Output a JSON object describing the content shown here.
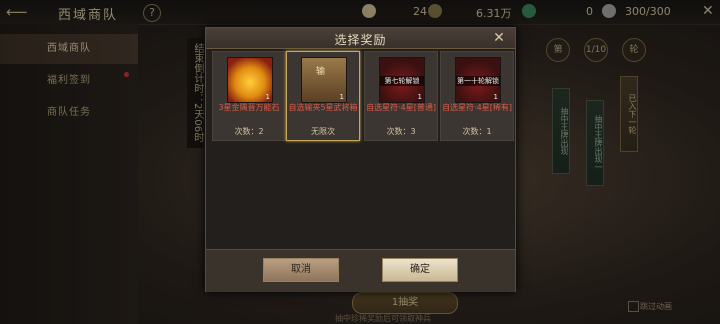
{
  "header": {
    "back_icon": "back-arrow-icon",
    "title": "西域商队",
    "help": "?",
    "res1": "24",
    "res2": "6.31万",
    "res3": "0",
    "res4": "300/300",
    "close": "✕"
  },
  "sidebar": {
    "items": [
      {
        "label": "西域商队",
        "active": true
      },
      {
        "label": "福利签到",
        "active": false
      },
      {
        "label": "商队任务",
        "active": false
      }
    ]
  },
  "timer": {
    "label": "结束倒计时：2天06时"
  },
  "right": {
    "badge_left": "第",
    "badge_mid": "1/10",
    "badge_right": "轮",
    "banner1": "抽中王牌出现",
    "banner2": "抽中王牌出现一",
    "banner3": "已入下一轮"
  },
  "bottom": {
    "draw_button": "1抽奖",
    "note": "抽中珍稀奖励后可领取神兵",
    "skip": "跳过动画"
  },
  "dialog": {
    "title": "选择奖励",
    "close": "✕",
    "items": [
      {
        "name": "3星金隅晋万能石",
        "count": "次数：2",
        "qty": "1",
        "selected": false,
        "overlay": ""
      },
      {
        "name": "自选输夹5星武将箱",
        "count": "无限次",
        "qty": "1",
        "selected": true,
        "overlay": "输"
      },
      {
        "name": "自选星符·4星[普通]",
        "count": "次数：3",
        "qty": "1",
        "selected": false,
        "overlay": "第七轮解锁"
      },
      {
        "name": "自选星符·4星[稀有]",
        "count": "次数：1",
        "qty": "1",
        "selected": false,
        "overlay": "第一十轮解锁"
      }
    ],
    "cancel": "取消",
    "confirm": "确定"
  }
}
